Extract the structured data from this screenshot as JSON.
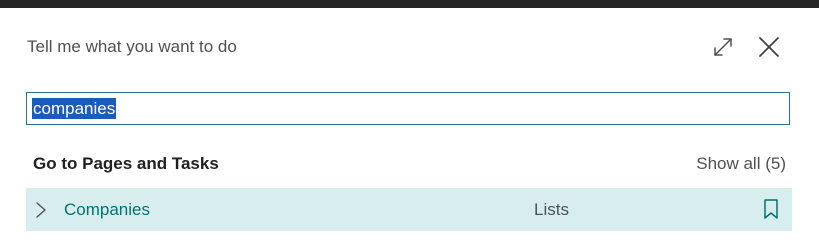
{
  "dialog": {
    "title": "Tell me what you want to do",
    "expand_icon": "expand-icon",
    "close_icon": "close-icon"
  },
  "search": {
    "value": "companies"
  },
  "results": {
    "section_heading": "Go to Pages and Tasks",
    "show_all_label": "Show all (5)",
    "rows": [
      {
        "name": "Companies",
        "category": "Lists",
        "icons": [
          "chevron-right-icon",
          "bookmark-icon"
        ]
      }
    ]
  },
  "colors": {
    "top_strip": "#262626",
    "search_border": "#2e6f8a",
    "selection_highlight": "#1e5ab8",
    "row_background": "#d8eeee",
    "accent_teal": "#00736f"
  }
}
